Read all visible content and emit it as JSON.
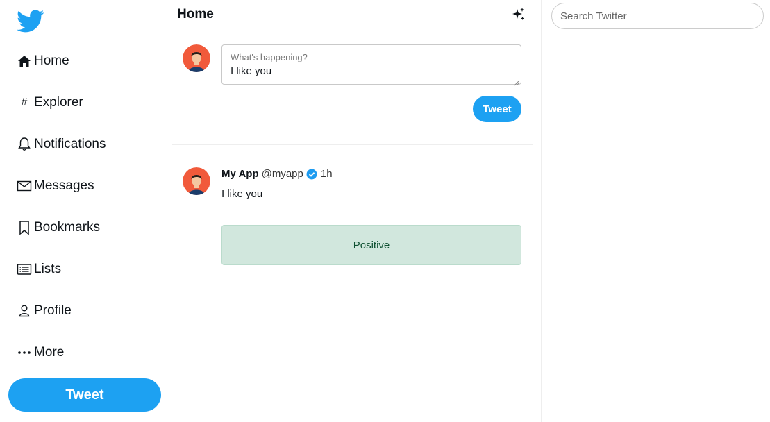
{
  "sidebar": {
    "items": [
      {
        "label": "Home",
        "icon": "home-icon"
      },
      {
        "label": "Explorer",
        "icon": "hash-icon"
      },
      {
        "label": "Notifications",
        "icon": "bell-icon"
      },
      {
        "label": "Messages",
        "icon": "envelope-icon"
      },
      {
        "label": "Bookmarks",
        "icon": "bookmark-icon"
      },
      {
        "label": "Lists",
        "icon": "list-icon"
      },
      {
        "label": "Profile",
        "icon": "person-icon"
      },
      {
        "label": "More",
        "icon": "more-icon"
      }
    ],
    "tweet_label": "Tweet"
  },
  "main": {
    "title": "Home",
    "compose": {
      "placeholder": "What's happening?",
      "value": "I like you",
      "tweet_label": "Tweet"
    },
    "post": {
      "name": "My App",
      "handle": "@myapp",
      "time": "1h",
      "text": "I like you",
      "sentiment": "Positive"
    }
  },
  "search": {
    "placeholder": "Search Twitter"
  },
  "colors": {
    "brand": "#1da1f2",
    "sentiment_bg": "#d1e7dd",
    "sentiment_text": "#0f5132"
  }
}
